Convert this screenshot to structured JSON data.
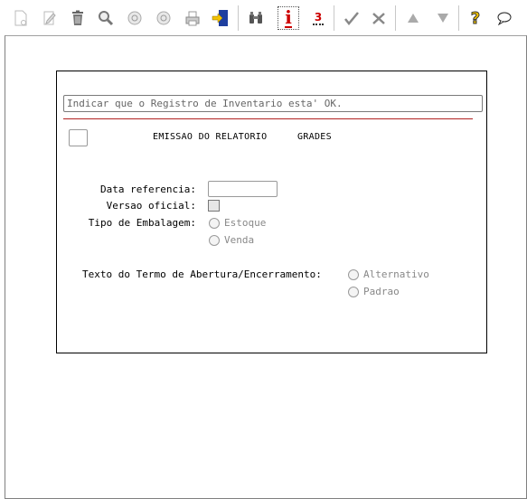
{
  "toolbar": {
    "buttons": [
      {
        "name": "new-icon"
      },
      {
        "name": "edit-icon"
      },
      {
        "name": "delete-icon"
      },
      {
        "name": "search-icon"
      },
      {
        "name": "previous-icon"
      },
      {
        "name": "next-icon"
      },
      {
        "name": "print-icon"
      },
      {
        "name": "exit-icon"
      },
      {
        "name": "binoculars-icon"
      },
      {
        "name": "info-icon"
      },
      {
        "name": "numbering-icon"
      },
      {
        "name": "confirm-icon"
      },
      {
        "name": "cancel-icon"
      },
      {
        "name": "up-icon"
      },
      {
        "name": "down-icon"
      },
      {
        "name": "help-icon"
      },
      {
        "name": "comment-icon"
      }
    ],
    "info_glyph": "i",
    "numbering_glyph": "3",
    "help_glyph": "?"
  },
  "form": {
    "message": "Indicar que o Registro de Inventario esta' OK.",
    "title": "EMISSAO DO RELATORIO",
    "subtitle": "GRADES",
    "data_referencia_label": "Data referencia:",
    "data_referencia_value": "",
    "versao_oficial_label": "Versao oficial:",
    "versao_oficial_checked": false,
    "tipo_embalagem_label": "Tipo de Embalagem:",
    "tipo_embalagem_options": [
      "Estoque",
      "Venda"
    ],
    "texto_termo_label": "Texto do Termo de Abertura/Encerramento:",
    "texto_termo_options": [
      "Alternativo",
      "Padrao"
    ]
  },
  "colors": {
    "accent_red": "#b22222",
    "exit_icon_blue": "#1f3f9f",
    "help_yellow": "#f2c200"
  }
}
